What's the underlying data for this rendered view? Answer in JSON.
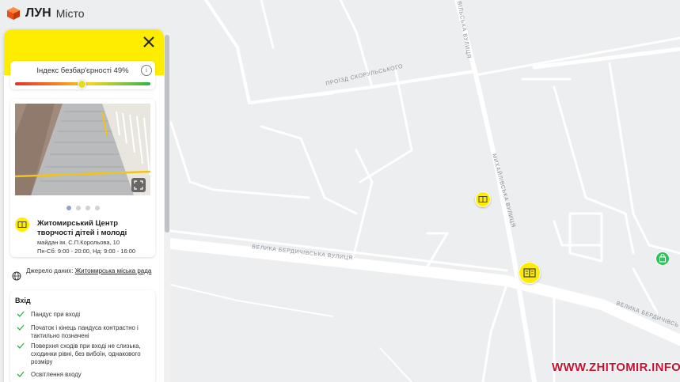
{
  "app": {
    "brand": "ЛУН",
    "product": "Місто"
  },
  "index": {
    "label": "Індекс безбар'єрності 49%",
    "value_percent": 49,
    "info_icon": "info-icon"
  },
  "place": {
    "name": "Житомирський Центр творчості дітей і молоді",
    "address": "майдан ім. С.П.Корольова, 10",
    "hours": "Пн-Сб: 9:00 - 20:00, Нд: 9:00 - 16:00",
    "photo_count": 4,
    "active_photo": 0
  },
  "source": {
    "prefix": "Джерело даних:",
    "link": "Житомирська міська рада"
  },
  "entry": {
    "title": "Вхід",
    "features": [
      "Пандус при вході",
      "Початок і кінець пандуса контрастно і тактильно позначені",
      "Поверхня сходів при вході не слизька, сходинки рівні, без вибоїн, однакового розміру",
      "Освітлення входу"
    ]
  },
  "map": {
    "streets": [
      "ПРОЇЗД СКОРУЛЬСЬКОГО",
      "МИХАЙЛІВСЬКА ВУЛИЦЯ",
      "ВЕЛИКА БЕРДИЧІВСЬКА ВУЛИЦЯ",
      "ВЕЛИКА БЕРДИЧІВСЬ",
      "ВІЛЬСЬКА ВУЛИЦЯ"
    ]
  },
  "watermark": "WWW.ZHITOMIR.INFO",
  "colors": {
    "accent_yellow": "#ffed00",
    "check_green": "#2db34a",
    "marker_green": "#2ec35a",
    "watermark_red": "#c8102e"
  }
}
